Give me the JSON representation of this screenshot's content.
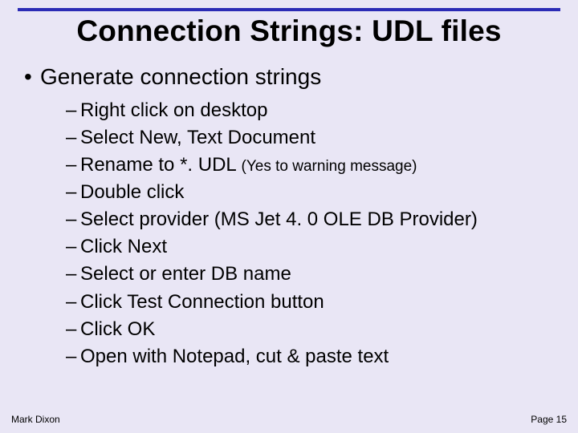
{
  "title": "Connection Strings: UDL files",
  "bullet": "Generate connection strings",
  "steps": [
    {
      "text": "Right click on desktop"
    },
    {
      "text": "Select New, Text Document"
    },
    {
      "text": "Rename to *. UDL ",
      "note": "(Yes to warning message)"
    },
    {
      "text": "Double click"
    },
    {
      "text": "Select provider (MS Jet 4. 0 OLE DB Provider)"
    },
    {
      "text": "Click Next"
    },
    {
      "text": "Select or enter DB name"
    },
    {
      "text": "Click Test Connection button"
    },
    {
      "text": "Click OK"
    },
    {
      "text": "Open with Notepad, cut & paste text"
    }
  ],
  "footer": {
    "author": "Mark Dixon",
    "page": "Page 15"
  }
}
